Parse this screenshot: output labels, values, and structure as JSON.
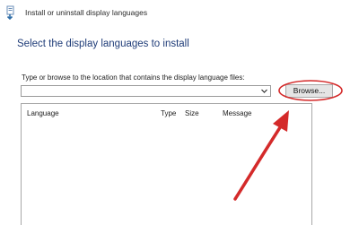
{
  "window": {
    "title": "Install or uninstall display languages"
  },
  "main": {
    "heading": "Select the display languages to install",
    "location_label": "Type or browse to the location that contains the display language files:",
    "location_value": "",
    "browse_label": "Browse..."
  },
  "list": {
    "columns": [
      "Language",
      "Type",
      "Size",
      "Message"
    ]
  },
  "icons": {
    "window_icon": "language-install-icon",
    "dropdown": "chevron-down-icon"
  },
  "colors": {
    "heading": "#1f3c78",
    "annotation": "#d42a2a"
  }
}
